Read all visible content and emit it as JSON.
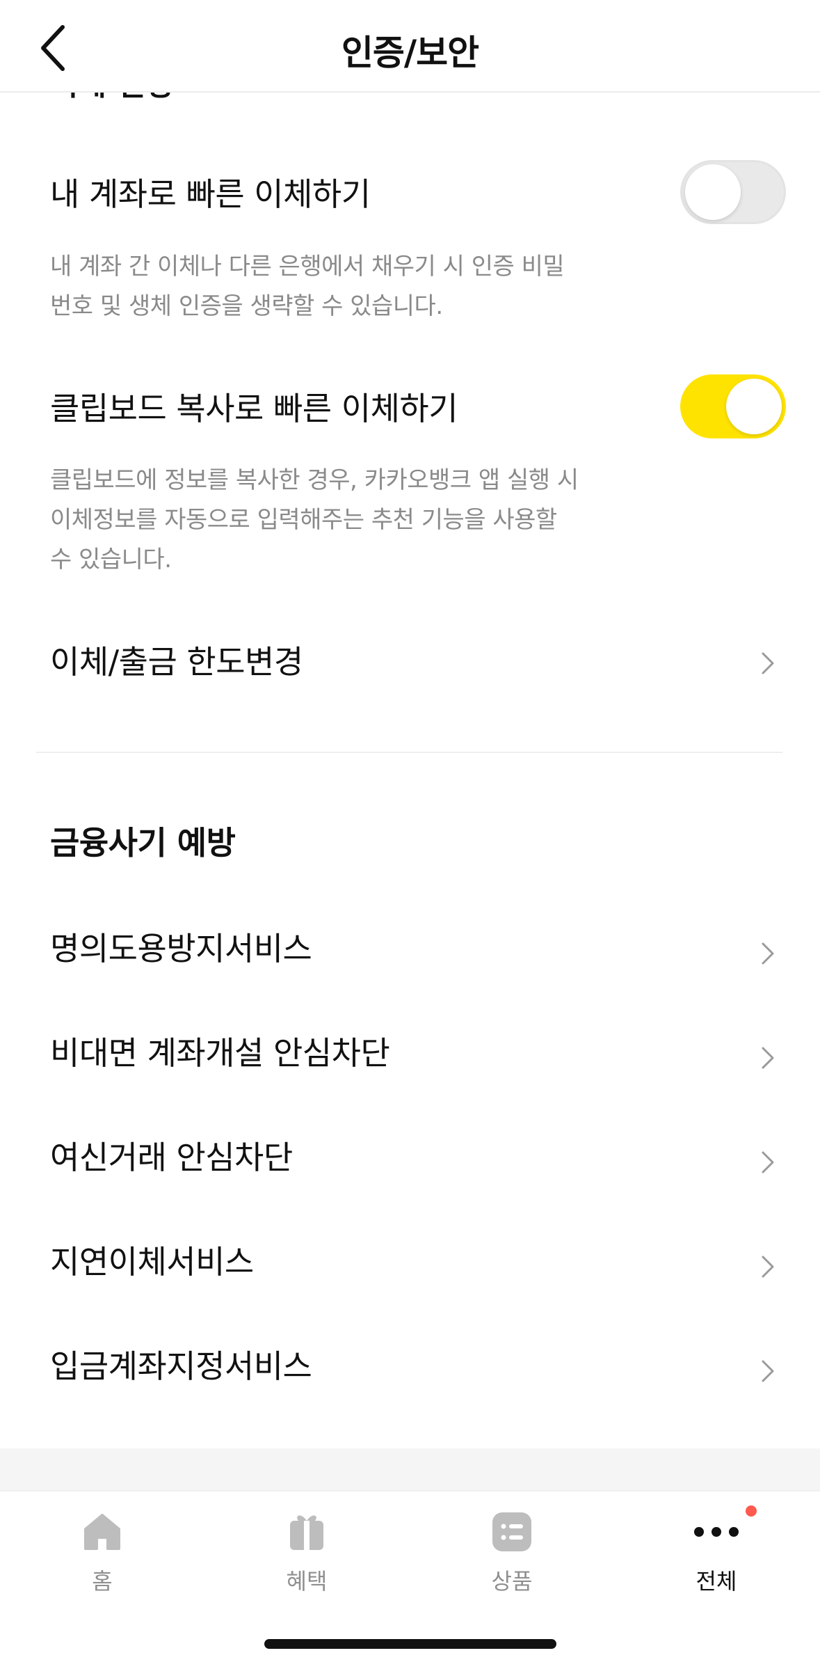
{
  "header": {
    "title": "인증/보안",
    "back_icon": "chevron-left-icon"
  },
  "transfer_settings": {
    "partial_heading": "이체 설정",
    "quick_own_account": {
      "label": "내 계좌로 빠른 이체하기",
      "description": "내 계좌 간 이체나 다른 은행에서 채우기 시 인증 비밀번호 및 생체 인증을 생략할 수 있습니다.",
      "enabled": false
    },
    "clipboard_quick": {
      "label": "클립보드 복사로 빠른 이체하기",
      "description": "클립보드에 정보를 복사한 경우, 카카오뱅크 앱 실행 시 이체정보를 자동으로 입력해주는 추천 기능을 사용할 수 있습니다.",
      "enabled": true
    },
    "limit_change": {
      "label": "이체/출금 한도변경"
    }
  },
  "fraud_prevention": {
    "title": "금융사기 예방",
    "items": [
      {
        "label": "명의도용방지서비스"
      },
      {
        "label": "비대면 계좌개설 안심차단"
      },
      {
        "label": "여신거래 안심차단"
      },
      {
        "label": "지연이체서비스"
      },
      {
        "label": "입금계좌지정서비스"
      }
    ]
  },
  "tabbar": {
    "tabs": [
      {
        "label": "홈",
        "icon": "home-icon",
        "active": false
      },
      {
        "label": "혜택",
        "icon": "gift-icon",
        "active": false
      },
      {
        "label": "상품",
        "icon": "list-icon",
        "active": false
      },
      {
        "label": "전체",
        "icon": "more-icon",
        "active": true,
        "badge": true
      }
    ]
  },
  "colors": {
    "accent": "#ffe300",
    "badge": "#ff5a4e",
    "tab_inactive": "#bdbdbd",
    "tab_active": "#111111"
  }
}
